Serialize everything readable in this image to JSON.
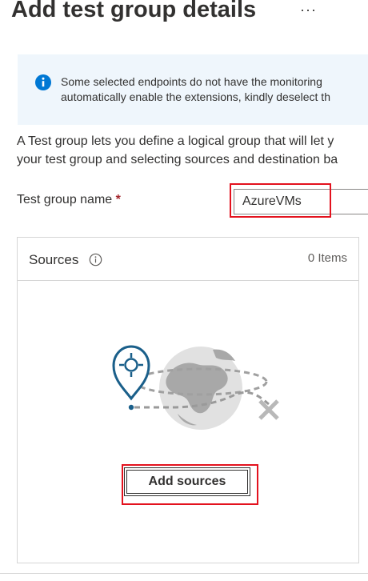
{
  "header": {
    "title": "Add test group details",
    "more_label": "···"
  },
  "info_bar": {
    "line1": "Some selected endpoints do not have the monitoring",
    "line2": "automatically enable the extensions, kindly deselect th"
  },
  "description": {
    "line1": "A Test group lets you define a logical group that will let y",
    "line2": "your test group and selecting sources and destination ba"
  },
  "test_group_name": {
    "label": "Test group name",
    "required_mark": "*",
    "value": "AzureVMs"
  },
  "sources_card": {
    "title": "Sources",
    "count": "0 Items",
    "add_button_label": "Add sources"
  },
  "icons": {
    "more": "more-ellipsis-icon",
    "info": "info-circle-icon",
    "illustration": "globe-location-pin-illustration"
  },
  "colors": {
    "info_bar_bg": "#eff6fc",
    "info_icon": "#0078d4",
    "required": "#a4262c",
    "highlight": "#e3121e",
    "pin": "#1a5f8a"
  }
}
